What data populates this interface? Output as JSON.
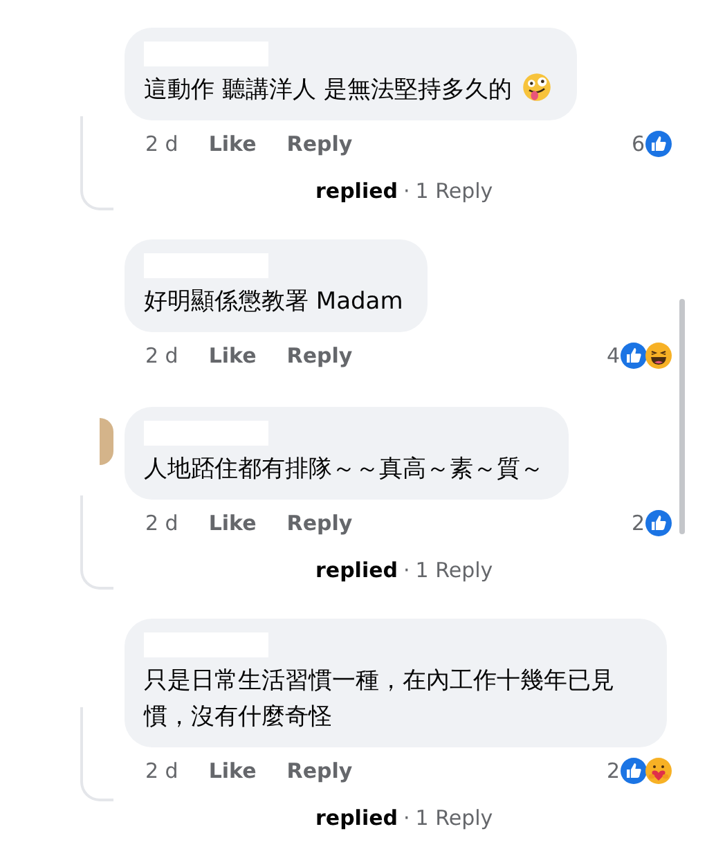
{
  "comments": [
    {
      "text": "這動作 聽講洋人 是無法堅持多久的",
      "end_emoji": {
        "kind": "zany"
      },
      "avatar_visible": false,
      "time": "2 d",
      "like": "Like",
      "reply": "Reply",
      "count": "6",
      "reactions": [
        {
          "kind": "like"
        }
      ],
      "replies": {
        "name": "replied",
        "separator": "·",
        "label": "1 Reply"
      }
    },
    {
      "text": "好明顯係懲教署 Madam",
      "avatar_visible": false,
      "time": "2 d",
      "like": "Like",
      "reply": "Reply",
      "count": "4",
      "reactions": [
        {
          "kind": "like"
        },
        {
          "kind": "haha"
        }
      ]
    },
    {
      "text": "人地踎住都有排隊～～真高～素～質～",
      "avatar_visible": true,
      "time": "2 d",
      "like": "Like",
      "reply": "Reply",
      "count": "2",
      "reactions": [
        {
          "kind": "like"
        }
      ],
      "replies": {
        "name": "replied",
        "separator": "·",
        "label": "1 Reply"
      }
    },
    {
      "text": "只是日常生活習慣一種，在內工作十幾年已見慣，沒有什麼奇怪",
      "avatar_visible": false,
      "time": "2 d",
      "like": "Like",
      "reply": "Reply",
      "count": "2",
      "reactions": [
        {
          "kind": "like"
        },
        {
          "kind": "care"
        }
      ],
      "replies": {
        "name": "replied",
        "separator": "·",
        "label": "1 Reply"
      }
    }
  ]
}
